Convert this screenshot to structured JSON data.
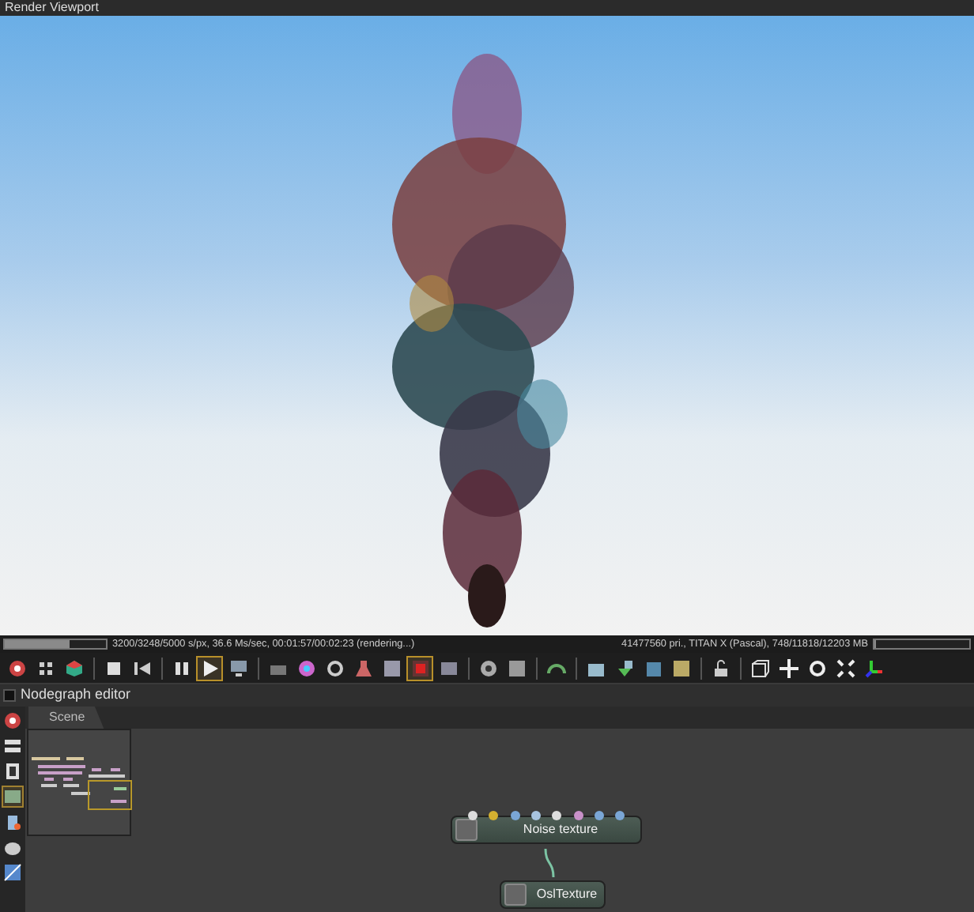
{
  "window": {
    "title": "Render Viewport"
  },
  "render_status": {
    "progress": {
      "level": 0.64
    },
    "text": "3200/3248/5000 s/px, 36.6 Ms/sec, 00:01:57/00:02:23 (rendering...)",
    "device_text": "41477560 pri., TITAN X (Pascal), 748/11818/12203 MB",
    "memory": {
      "level": 0.02
    }
  },
  "toolbar": [
    {
      "selected": false
    },
    {
      "selected": false
    },
    {
      "selected": false
    },
    {
      "selected": false
    },
    {
      "selected": false
    },
    {
      "selected": false
    },
    {
      "selected": true
    },
    {
      "selected": false
    },
    {
      "selected": false
    },
    {
      "selected": false
    },
    {
      "selected": false
    },
    {
      "selected": false
    },
    {
      "selected": false
    },
    {
      "selected": true
    },
    {
      "selected": false
    },
    {
      "selected": false
    },
    {
      "selected": false
    },
    {
      "selected": false
    },
    {
      "selected": false
    },
    {
      "selected": false
    },
    {
      "selected": false
    },
    {
      "selected": false
    },
    {
      "selected": false
    },
    {
      "selected": false
    },
    {
      "selected": false
    },
    {
      "selected": false
    },
    {
      "selected": false
    },
    {
      "selected": false
    }
  ],
  "nodegraph": {
    "title": "Nodegraph editor",
    "side_tools": [
      {
        "selected": false
      },
      {
        "selected": false
      },
      {
        "selected": false
      },
      {
        "selected": true
      },
      {
        "selected": false
      },
      {
        "selected": false
      },
      {
        "selected": false
      }
    ],
    "tabs": [
      {
        "label": "Scene",
        "selected": true
      }
    ],
    "nodes": [
      {
        "label": "Noise texture",
        "pins": [
          {
            "color": "#dddddd"
          },
          {
            "color": "#d4b030"
          },
          {
            "color": "#7aa6d6"
          },
          {
            "color": "#a8c4e0"
          },
          {
            "color": "#dddddd"
          },
          {
            "color": "#c890c8"
          },
          {
            "color": "#7aa6d6"
          },
          {
            "color": "#7aa6d6"
          }
        ]
      },
      {
        "label": "OslTexture"
      }
    ]
  }
}
